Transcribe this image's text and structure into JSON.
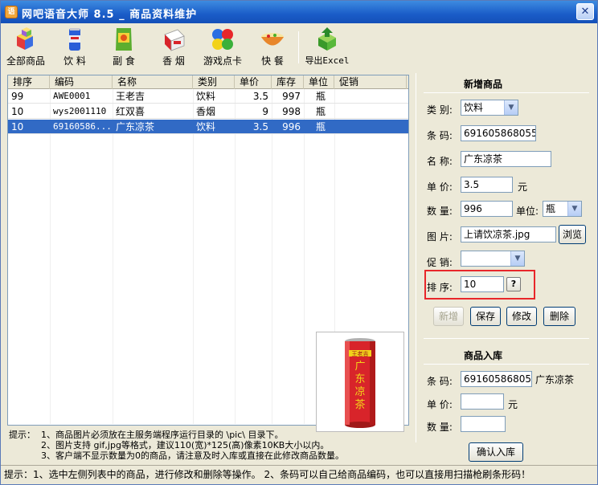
{
  "window": {
    "title": "网吧语音大师 8.5 _ 商品资料维护",
    "app_icon_text": "语",
    "close_glyph": "✕"
  },
  "toolbar": [
    {
      "label": "全部商品",
      "icon": "cubes-icon"
    },
    {
      "label": "饮 料",
      "icon": "soda-can-icon"
    },
    {
      "label": "副 食",
      "icon": "snack-bag-icon"
    },
    {
      "label": "香 烟",
      "icon": "cigarette-pack-icon"
    },
    {
      "label": "游戏点卡",
      "icon": "game-card-icon"
    },
    {
      "label": "快 餐",
      "icon": "noodle-bowl-icon"
    },
    {
      "label": "导出Excel",
      "icon": "export-excel-icon"
    }
  ],
  "table": {
    "columns": [
      "排序",
      "编码",
      "名称",
      "类别",
      "单价",
      "库存",
      "单位",
      "促销"
    ],
    "rows": [
      {
        "sort": "99",
        "code": "AWE0001",
        "name": "王老吉",
        "category": "饮料",
        "price": "3.5",
        "stock": "997",
        "unit": "瓶",
        "promo": "",
        "selected": false
      },
      {
        "sort": "10",
        "code": "wys2001110",
        "name": "红双喜",
        "category": "香烟",
        "price": "9",
        "stock": "998",
        "unit": "瓶",
        "promo": "",
        "selected": false
      },
      {
        "sort": "10",
        "code": "69160586...",
        "name": "广东凉茶",
        "category": "饮料",
        "price": "3.5",
        "stock": "996",
        "unit": "瓶",
        "promo": "",
        "selected": true
      }
    ]
  },
  "product_image": {
    "label_text": "广东凉茶",
    "brand": "王老吉"
  },
  "tips": {
    "label": "提示：",
    "lines": [
      "1、商品图片必须放在主服务端程序运行目录的 \\pic\\ 目录下。",
      "2、图片支持 gif,jpg等格式，建议110(宽)*125(高)像素10KB大小以内。",
      "3、客户端不显示数量为0的商品，请注意及时入库或直接在此修改商品数量。"
    ]
  },
  "statusbar": "提示：1、选中左侧列表中的商品，进行修改和删除等操作。  2、条码可以自己给商品编码，也可以直接用扫描枪刷条形码！",
  "new_product": {
    "title": "新增商品",
    "category_label": "类 别:",
    "category_value": "饮料",
    "barcode_label": "条 码:",
    "barcode_value": "6916058680559",
    "name_label": "名 称:",
    "name_value": "广东凉茶",
    "price_label": "单 价:",
    "price_value": "3.5",
    "price_unit": "元",
    "qty_label": "数 量:",
    "qty_value": "996",
    "unit_label": "单位:",
    "unit_value": "瓶",
    "image_label": "图 片:",
    "image_value": "上请饮凉茶.jpg",
    "browse_button": "浏览",
    "promo_label": "促 销:",
    "promo_value": "",
    "sort_label": "排 序:",
    "sort_value": "10",
    "help_button": "?",
    "buttons": {
      "add": "新增",
      "save": "保存",
      "edit": "修改",
      "delete": "删除"
    }
  },
  "stock_in": {
    "title": "商品入库",
    "barcode_label": "条 码:",
    "barcode_value": "6916058680559",
    "product_name": "广东凉茶",
    "price_label": "单 价:",
    "price_value": "",
    "price_unit": "元",
    "qty_label": "数 量:",
    "qty_value": "",
    "confirm_button": "确认入库"
  }
}
